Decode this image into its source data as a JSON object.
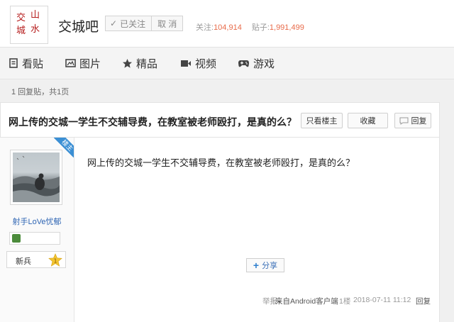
{
  "header": {
    "logo_chars": [
      "交",
      "山",
      "城",
      "水"
    ],
    "forum_name": "交城吧",
    "follow_label": "已关注",
    "cancel_label": "取 消",
    "stats": {
      "follow_label": "关注:",
      "follow_count": "104,914",
      "posts_label": "贴子:",
      "posts_count": "1,991,499"
    }
  },
  "nav": {
    "items": [
      {
        "label": "看贴",
        "icon": "document-icon"
      },
      {
        "label": "图片",
        "icon": "image-icon"
      },
      {
        "label": "精品",
        "icon": "star-icon"
      },
      {
        "label": "视频",
        "icon": "video-icon"
      },
      {
        "label": "游戏",
        "icon": "gamepad-icon"
      }
    ]
  },
  "pager": {
    "text": "1 回复贴，共1页"
  },
  "thread": {
    "title": "网上传的交城一学生不交辅导费，在教室被老师殴打，是真的么？",
    "buttons": {
      "only_op": "只看楼主",
      "favorite": "收藏",
      "reply": "回复"
    }
  },
  "post": {
    "op_ribbon": "楼主",
    "username": "射手LoVe忧郁",
    "rank": "新兵",
    "rank_level": "1",
    "content": "网上传的交城一学生不交辅导费，在教室被老师殴打，是真的么？",
    "share_label": "分享",
    "meta": {
      "report": "举报",
      "source": "来自Android客户端",
      "floor": "1楼",
      "time": "2018-07-11 11:12",
      "reply": "回复"
    }
  },
  "colors": {
    "accent_blue": "#3b8fd4",
    "number_orange": "#e86b4a",
    "logo_red": "#b51b1b",
    "link_blue": "#2d64b3"
  }
}
